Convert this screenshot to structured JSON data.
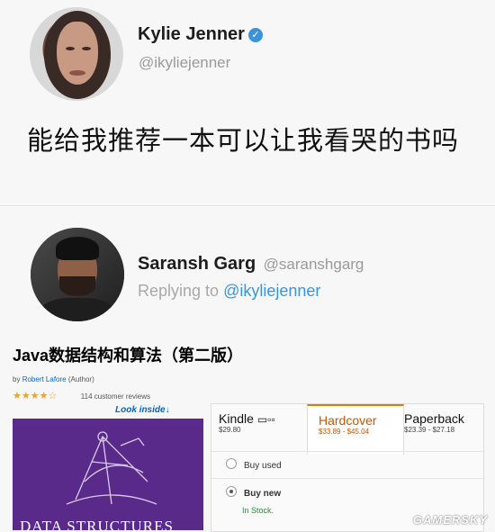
{
  "tweet1": {
    "name": "Kylie Jenner",
    "handle": "@ikyliejenner",
    "text": "能给我推荐一本可以让我看哭的书吗"
  },
  "tweet2": {
    "name": "Saransh Garg",
    "handle": "@saranshgarg",
    "reply_prefix": "Replying to",
    "reply_mention": "@ikyliejenner"
  },
  "book": {
    "title": "Java数据结构和算法（第二版）",
    "by_prefix": "by",
    "author": "Robert Lafore",
    "author_role": "(Author)",
    "stars": "★★★★☆",
    "reviews": "114 customer reviews",
    "look_inside": "Look inside",
    "cover_text": "DATA STRUCTURES"
  },
  "formats": [
    {
      "label": "Kindle",
      "price": "$29.80",
      "selected": false
    },
    {
      "label": "Hardcover",
      "price": "$33.89 - $45.04",
      "selected": true
    },
    {
      "label": "Paperback",
      "price": "$23.39 - $27.18",
      "selected": false
    }
  ],
  "buy_options": {
    "used_label": "Buy used",
    "new_label": "Buy new",
    "stock": "In Stock."
  },
  "watermark": "GAMERSKY",
  "colors": {
    "verified": "#3b94d9",
    "mention": "#3b94d9",
    "selected_format": "#c45500",
    "cover": "#5a2a8a"
  }
}
